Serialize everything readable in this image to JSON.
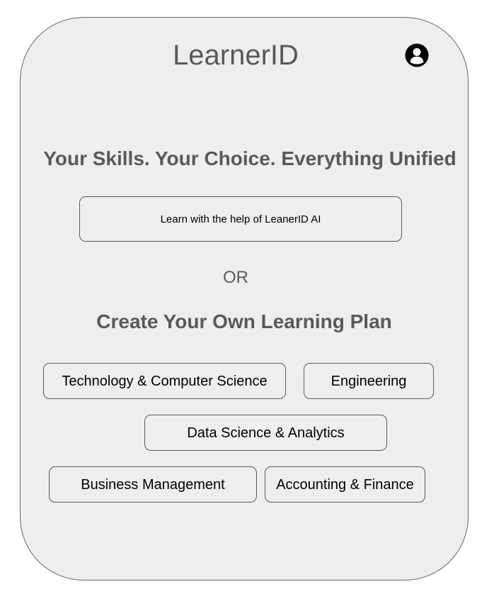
{
  "header": {
    "app_title": "LearnerID",
    "profile_icon": "user-circle-icon"
  },
  "hero": {
    "tagline": "Your Skills. Your Choice. Everything Unified"
  },
  "ai_option": {
    "label": "Learn with the help of LeanerID AI"
  },
  "divider": {
    "label": "OR"
  },
  "plan": {
    "heading": "Create Your Own Learning Plan",
    "categories": [
      {
        "label": "Technology & Computer Science"
      },
      {
        "label": "Engineering"
      },
      {
        "label": "Data Science & Analytics"
      },
      {
        "label": "Business Management"
      },
      {
        "label": "Accounting & Finance"
      }
    ]
  },
  "colors": {
    "background": "#eeeeee",
    "border": "#595959",
    "heading_text": "#595959",
    "button_text": "#000000"
  }
}
